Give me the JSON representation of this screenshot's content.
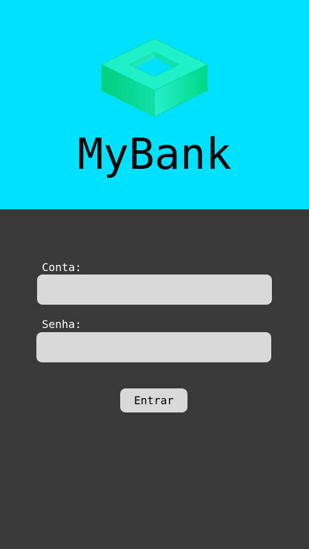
{
  "app": {
    "title": "MyBank",
    "logo_icon": "bank-logo-icon",
    "colors": {
      "header_background": "#00e0ff",
      "body_background": "#393939",
      "field_background": "#d9d9d9",
      "logo_green": "#00d98c",
      "logo_mint": "#1ff0c0"
    }
  },
  "login_form": {
    "account_label": "Conta:",
    "account_value": "",
    "password_label": "Senha:",
    "password_value": "",
    "submit_label": "Entrar"
  }
}
